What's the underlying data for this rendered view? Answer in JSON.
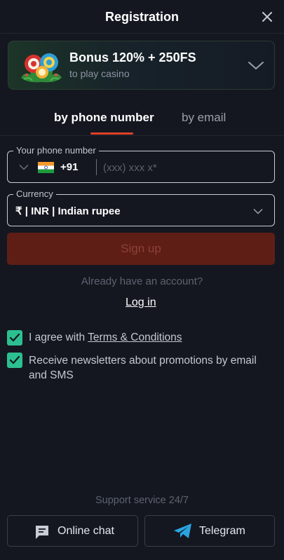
{
  "header": {
    "title": "Registration"
  },
  "bonus": {
    "title": "Bonus 120% + 250FS",
    "subtitle": "to play casino"
  },
  "tabs": [
    {
      "label": "by phone number",
      "active": true
    },
    {
      "label": "by email",
      "active": false
    }
  ],
  "phone": {
    "legend": "Your phone number",
    "country_code": "+91",
    "value": "",
    "placeholder": "(xxx) xxx x*"
  },
  "currency": {
    "legend": "Currency",
    "value": "₹ | INR | Indian rupee"
  },
  "signup_label": "Sign up",
  "already_text": "Already have an account?",
  "login_label": "Log in",
  "agreements": [
    {
      "prefix": "I agree with ",
      "link": "Terms & Conditions",
      "checked": true
    },
    {
      "text": "Receive newsletters about promotions by email and SMS",
      "checked": true
    }
  ],
  "support": {
    "title": "Support service 24/7",
    "chat_label": "Online chat",
    "telegram_label": "Telegram"
  },
  "colors": {
    "background": "#141720",
    "accent": "#e2402a",
    "checkbox": "#2cbf8f",
    "signup_disabled": "#5e1e16"
  },
  "icons": [
    "close-icon",
    "casino-chips-icon",
    "chevron-down-icon",
    "india-flag-icon",
    "check-icon",
    "chat-icon",
    "telegram-icon"
  ]
}
